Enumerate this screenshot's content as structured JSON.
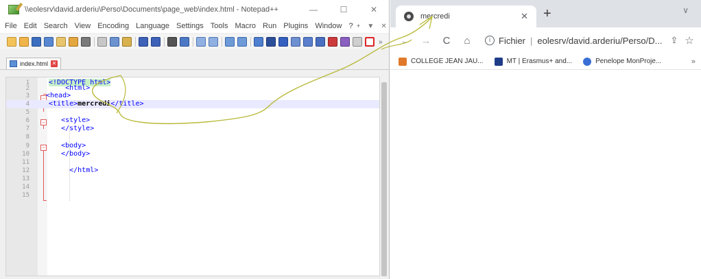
{
  "notepad": {
    "title": "\\\\eolesrv\\david.arderiu\\Perso\\Documents\\page_web\\index.html - Notepad++",
    "window_controls": [
      "—",
      "☐",
      "✕"
    ],
    "menu": [
      "File",
      "Edit",
      "Search",
      "View",
      "Encoding",
      "Language",
      "Settings",
      "Tools",
      "Macro",
      "Run",
      "Plugins",
      "Window",
      "?"
    ],
    "menu_right": [
      "+",
      "▼",
      "✕"
    ],
    "toolbar_more": "»",
    "tab": {
      "label": "index.html",
      "close": "✕"
    },
    "lines": [
      {
        "n": "1",
        "pre": "",
        "tag": "<!DOCTYPE html>"
      },
      {
        "n": "2",
        "pre": "    ",
        "tag": "<html>"
      },
      {
        "n": "3",
        "pre": "",
        "tag": "<head>"
      },
      {
        "n": "4",
        "pre": "",
        "tag_open": "<title>",
        "text": "mercredi",
        "tag_close": "</title>"
      },
      {
        "n": "5",
        "pre": "",
        "tag": ""
      },
      {
        "n": "6",
        "pre": "   ",
        "tag": "<style>"
      },
      {
        "n": "7",
        "pre": "   ",
        "tag": "</style>"
      },
      {
        "n": "8",
        "pre": "",
        "tag": ""
      },
      {
        "n": "9",
        "pre": "   ",
        "tag": "<body>"
      },
      {
        "n": "10",
        "pre": "   ",
        "tag": "</body>"
      },
      {
        "n": "11",
        "pre": "",
        "tag": ""
      },
      {
        "n": "12",
        "pre": "     ",
        "tag": "</html>"
      },
      {
        "n": "13",
        "pre": "",
        "tag": ""
      },
      {
        "n": "14",
        "pre": "",
        "tag": ""
      },
      {
        "n": "15",
        "pre": "",
        "tag": ""
      }
    ]
  },
  "browser": {
    "tab_title": "mercredi",
    "tab_close": "✕",
    "new_tab": "+",
    "tab_menu": "∨",
    "nav": {
      "back": "←",
      "forward": "→",
      "reload": "C",
      "home": "⌂"
    },
    "protocol": "Fichier",
    "divider": "|",
    "url": "eolesrv/david.arderiu/Perso/D...",
    "share": "⇪",
    "star": "☆",
    "info": "i",
    "bookmarks": [
      {
        "label": "COLLEGE JEAN JAU...",
        "color": "#e07a2a"
      },
      {
        "label": "MT | Erasmus+ and...",
        "color": "#1f3c88"
      },
      {
        "label": "Penelope MonProje...",
        "color": "#3a6fd6"
      }
    ],
    "bookmarks_more": "»"
  },
  "colors": {
    "tag_blue": "#0000ff",
    "line_highlight": "#e9e9ff",
    "scribble": "#b9b93a",
    "browser_frame": "#dee1e6"
  }
}
